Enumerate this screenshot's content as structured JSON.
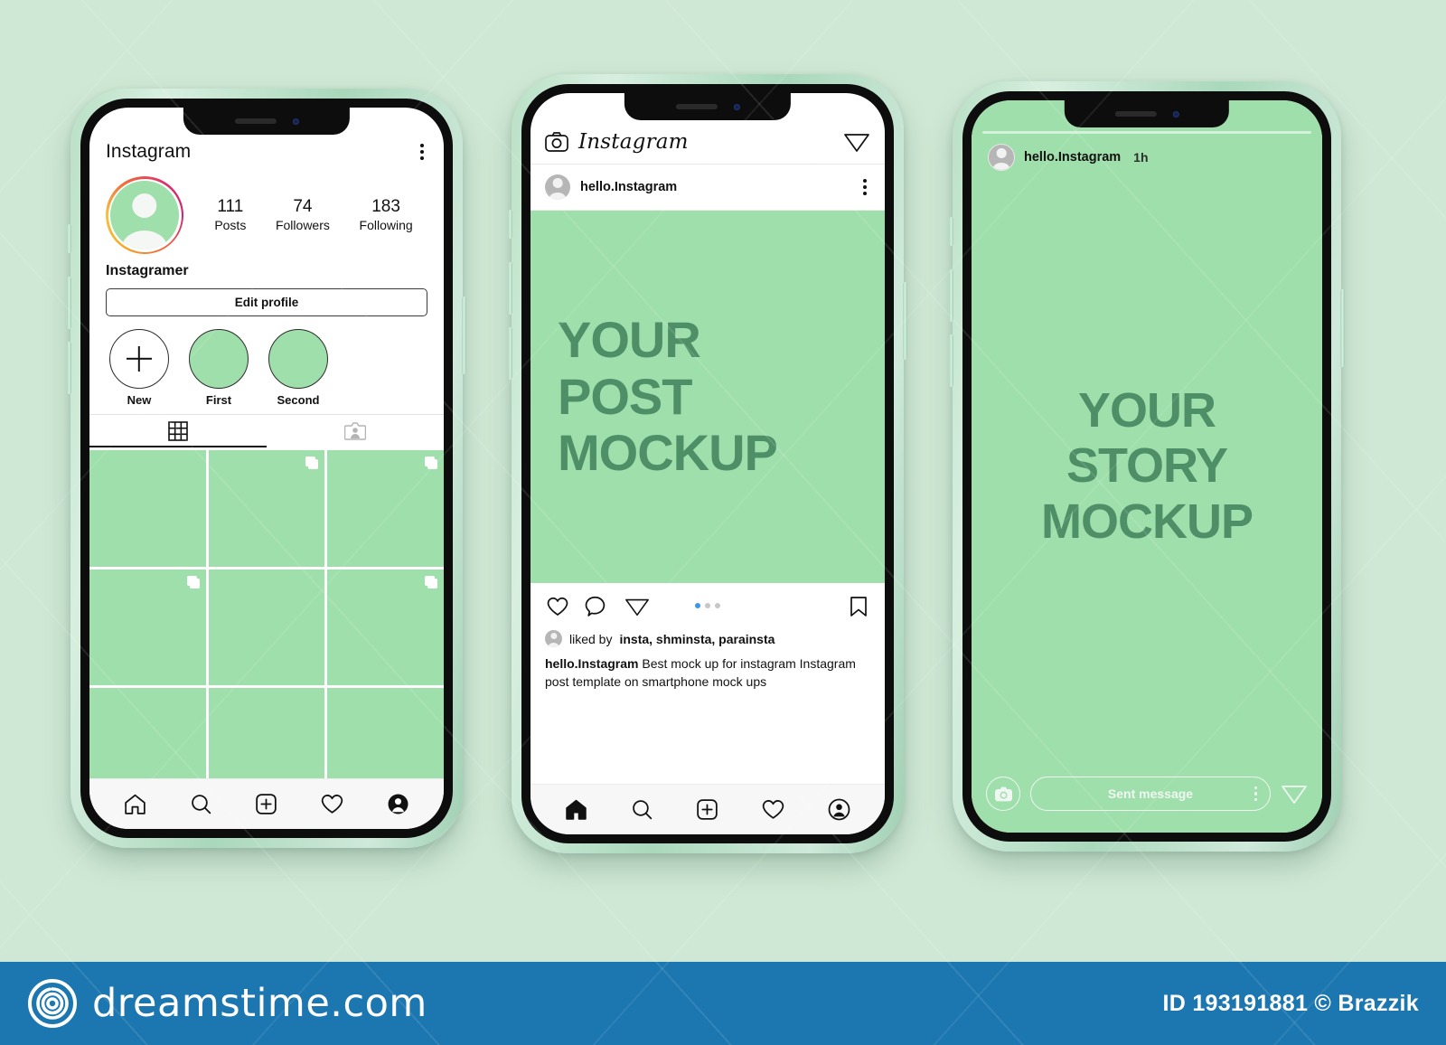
{
  "page": {
    "background_color": "#cfe8d5",
    "accent_green": "#9fdfab",
    "text_green": "#4f8f67"
  },
  "phone1": {
    "header": {
      "title": "Instagram",
      "menu_icon": "kebab-menu-icon"
    },
    "profile": {
      "avatar_icon": "profile-avatar",
      "name": "Instagramer",
      "stats": [
        {
          "value": "111",
          "label": "Posts"
        },
        {
          "value": "74",
          "label": "Followers"
        },
        {
          "value": "183",
          "label": "Following"
        }
      ],
      "edit_button": "Edit profile"
    },
    "highlights": [
      {
        "label": "New",
        "type": "add"
      },
      {
        "label": "First",
        "type": "image"
      },
      {
        "label": "Second",
        "type": "image"
      }
    ],
    "tabs": [
      {
        "icon": "grid-icon",
        "active": true
      },
      {
        "icon": "tagged-photos-icon",
        "active": false
      }
    ],
    "grid": [
      {
        "multi": false
      },
      {
        "multi": true
      },
      {
        "multi": true
      },
      {
        "multi": true
      },
      {
        "multi": false
      },
      {
        "multi": true
      },
      {
        "multi": false
      },
      {
        "multi": false
      },
      {
        "multi": false
      }
    ],
    "nav": [
      {
        "icon": "home-icon",
        "active": false
      },
      {
        "icon": "search-icon",
        "active": false
      },
      {
        "icon": "add-post-icon",
        "active": false
      },
      {
        "icon": "heart-icon",
        "active": false
      },
      {
        "icon": "profile-icon",
        "active": true
      }
    ]
  },
  "phone2": {
    "topbar": {
      "camera_icon": "camera-icon",
      "logo_text": "Instagram",
      "send_icon": "send-icon"
    },
    "post_header": {
      "avatar_icon": "user-avatar",
      "username": "hello.Instagram",
      "menu_icon": "kebab-menu-icon"
    },
    "post_image": {
      "lines": [
        "YOUR",
        "POST",
        "MOCKUP"
      ]
    },
    "actions": {
      "like_icon": "heart-icon",
      "comment_icon": "comment-icon",
      "share_icon": "send-icon",
      "save_icon": "bookmark-icon",
      "carousel_dots": 3,
      "carousel_active_index": 0
    },
    "liked_by": {
      "prefix": "liked by",
      "names": "insta, shminsta, parainsta"
    },
    "caption": {
      "username": "hello.Instagram",
      "text": "Best mock up for instagram Instagram post template on smartphone mock ups"
    },
    "nav": [
      {
        "icon": "home-icon",
        "active": true
      },
      {
        "icon": "search-icon",
        "active": false
      },
      {
        "icon": "add-post-icon",
        "active": false
      },
      {
        "icon": "heart-icon",
        "active": false
      },
      {
        "icon": "profile-icon",
        "active": false
      }
    ]
  },
  "phone3": {
    "story_header": {
      "avatar_icon": "user-avatar",
      "username": "hello.Instagram",
      "time": "1h"
    },
    "story_body": {
      "lines": [
        "YOUR",
        "STORY",
        "MOCKUP"
      ]
    },
    "story_footer": {
      "camera_icon": "camera-icon",
      "message_placeholder": "Sent message",
      "menu_icon": "kebab-menu-icon",
      "send_icon": "send-icon"
    }
  },
  "watermark": {
    "logo_icon": "dreamstime-spiral-logo",
    "site": "dreamstime.com",
    "credit": "ID 193191881 © Brazzik",
    "bar_color": "#1c76b0"
  }
}
